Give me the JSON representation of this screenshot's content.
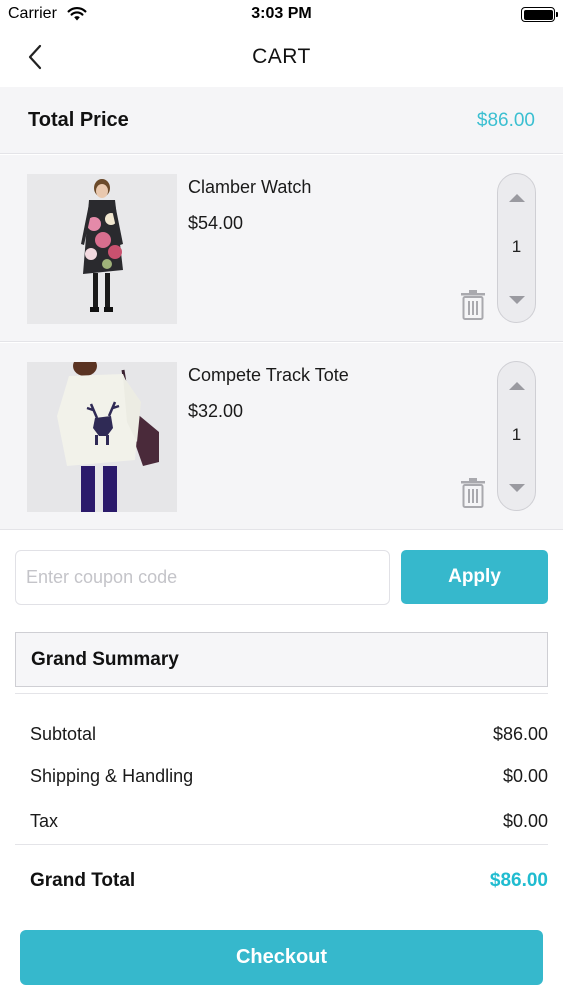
{
  "status_bar": {
    "carrier": "Carrier",
    "time": "3:03 PM",
    "wifi_icon": "wifi-icon",
    "battery_icon": "battery-icon"
  },
  "nav": {
    "title": "CART",
    "back_icon": "chevron-left-icon"
  },
  "total": {
    "label": "Total Price",
    "value": "$86.00"
  },
  "cart_items": [
    {
      "name": "Clamber Watch",
      "price": "$54.00",
      "quantity": "1",
      "image": "woman in floral dress product photo"
    },
    {
      "name": "Compete Track Tote",
      "price": "$32.00",
      "quantity": "1",
      "image": "woman in white deer sweatshirt product photo"
    }
  ],
  "coupon": {
    "placeholder": "Enter coupon code",
    "value": "",
    "apply_label": "Apply"
  },
  "summary": {
    "title": "Grand Summary",
    "rows": [
      {
        "label": "Subtotal",
        "value": "$86.00"
      },
      {
        "label": "Shipping & Handling",
        "value": "$0.00"
      },
      {
        "label": "Tax",
        "value": "$0.00"
      }
    ],
    "grand_total_label": "Grand Total",
    "grand_total_value": "$86.00"
  },
  "checkout_label": "Checkout",
  "colors": {
    "accent": "#36b8cc",
    "price_accent": "#3bbfd1",
    "background_strip": "#f5f5f7"
  }
}
